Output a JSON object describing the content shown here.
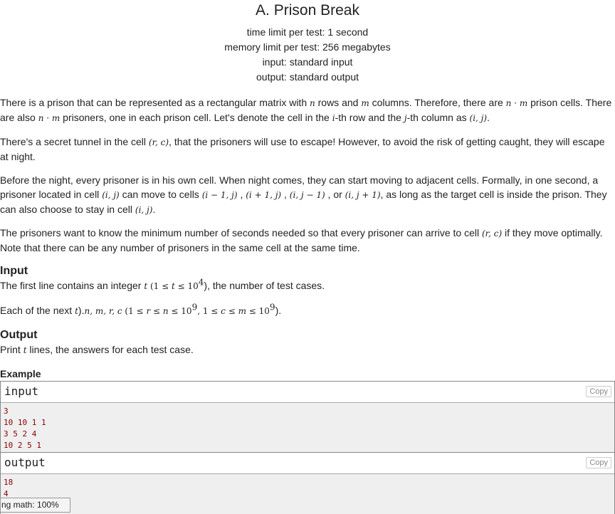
{
  "header": {
    "title": "A. Prison Break",
    "time_limit": "time limit per test: 1 second",
    "memory_limit": "memory limit per test: 256 megabytes",
    "input": "input: standard input",
    "output": "output: standard output"
  },
  "statement": {
    "p1a": "There is a prison that can be represented as a rectangular matrix with ",
    "p1_n": "n",
    "p1b": " rows and ",
    "p1_m": "m",
    "p1c": " columns. Therefore, there are ",
    "p1_nm": "n · m",
    "p1d": " prison cells. There are also ",
    "p1_nm2": "n · m",
    "p1e": " prisoners, one in each prison cell. Let's denote the cell in the ",
    "p1_i": "i",
    "p1f": "-th row and the ",
    "p1_j": "j",
    "p1g": "-th column as ",
    "p1_ij": "(i, j)",
    "p1h": ".",
    "p2a": "There's a secret tunnel in the cell ",
    "p2_rc": "(r, c)",
    "p2b": ", that the prisoners will use to escape! However, to avoid the risk of getting caught, they will escape at night.",
    "p3a": "Before the night, every prisoner is in his own cell. When night comes, they can start moving to adjacent cells. Formally, in one second, a prisoner located in cell ",
    "p3_ij": "(i, j)",
    "p3b": " can move to cells ",
    "p3_c1": "(i − 1, j)",
    "p3_s1": " , ",
    "p3_c2": "(i + 1, j)",
    "p3_s2": " , ",
    "p3_c3": "(i, j − 1)",
    "p3_s3": " , or ",
    "p3_c4": "(i, j + 1)",
    "p3c": ", as long as the target cell is inside the prison. They can also choose to stay in cell ",
    "p3_ij2": "(i, j)",
    "p3d": ".",
    "p4a": "The prisoners want to know the minimum number of seconds needed so that every prisoner can arrive to cell ",
    "p4_rc": "(r, c)",
    "p4b": " if they move optimally. Note that there can be any number of prisoners in the same cell at the same time."
  },
  "input_section": {
    "title": "Input",
    "l1a": "The first line contains an integer ",
    "l1_t": "t",
    "l1_c1": " (1 ≤ ",
    "l1_t2": "t",
    "l1_c2": " ≤ 10",
    "l1_exp": "4",
    "l1b": "), the number of test cases.",
    "l2a": "Each of the next ",
    "l2_t": "t",
    "l2b": ").",
    "l2_vars": "n, m, r, c",
    "l2_c1": " (1 ≤ ",
    "l2_r": "r",
    "l2_c2": " ≤ ",
    "l2_n": "n",
    "l2_c3": " ≤ 10",
    "l2_exp1": "9",
    "l2_c4": ", 1 ≤ ",
    "l2_c": "c",
    "l2_c5": " ≤ ",
    "l2_m": "m",
    "l2_c6": " ≤ 10",
    "l2_exp2": "9"
  },
  "output_section": {
    "title": "Output",
    "l1a": "Print ",
    "l1_t": "t",
    "l1b": " lines, the answers for each test case."
  },
  "example": {
    "title": "Example",
    "input_label": "input",
    "output_label": "output",
    "copy_label": "Copy",
    "input_lines": [
      "3",
      "10 10 1 1",
      "3 5 2 4",
      "10 2 5 1"
    ],
    "output_lines": [
      "18",
      "4"
    ]
  },
  "status_bar": {
    "text": "ng math: 100%"
  }
}
